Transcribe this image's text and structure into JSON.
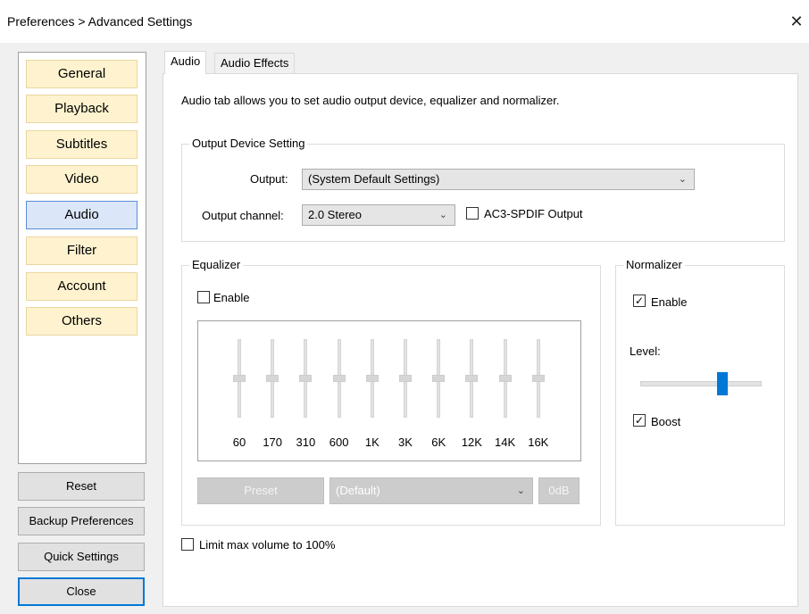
{
  "window": {
    "title": "Preferences > Advanced Settings",
    "close_glyph": "✕"
  },
  "sidebar": {
    "categories": [
      {
        "label": "General",
        "active": false
      },
      {
        "label": "Playback",
        "active": false
      },
      {
        "label": "Subtitles",
        "active": false
      },
      {
        "label": "Video",
        "active": false
      },
      {
        "label": "Audio",
        "active": true
      },
      {
        "label": "Filter",
        "active": false
      },
      {
        "label": "Account",
        "active": false
      },
      {
        "label": "Others",
        "active": false
      }
    ],
    "buttons": {
      "reset": "Reset",
      "backup": "Backup Preferences",
      "quick": "Quick Settings",
      "close": "Close"
    }
  },
  "tabs": [
    {
      "label": "Audio",
      "active": true
    },
    {
      "label": "Audio Effects",
      "active": false
    }
  ],
  "audio": {
    "description": "Audio tab allows you to set audio output device, equalizer and normalizer.",
    "output_group": {
      "title": "Output Device Setting",
      "output_label": "Output:",
      "output_value": "(System Default Settings)",
      "channel_label": "Output channel:",
      "channel_value": "2.0 Stereo",
      "spdif_label": "AC3-SPDIF Output",
      "spdif_checked": false
    },
    "equalizer": {
      "title": "Equalizer",
      "enable_label": "Enable",
      "enabled": false,
      "bands": [
        "60",
        "170",
        "310",
        "600",
        "1K",
        "3K",
        "6K",
        "12K",
        "14K",
        "16K"
      ],
      "band_levels": [
        0.5,
        0.5,
        0.5,
        0.5,
        0.5,
        0.5,
        0.5,
        0.5,
        0.5,
        0.5
      ],
      "preset_button": "Preset",
      "preset_value": "(Default)",
      "db_button": "0dB"
    },
    "normalizer": {
      "title": "Normalizer",
      "enable_label": "Enable",
      "enabled": true,
      "level_label": "Level:",
      "level_fraction": 0.68,
      "boost_label": "Boost",
      "boost": true
    },
    "limit_volume_label": "Limit max volume to 100%",
    "limit_volume": false
  },
  "colors": {
    "category_bg": "#fff3cf",
    "category_active_bg": "#dbe7f8",
    "accent": "#0078d7"
  },
  "icons": {
    "dropdown": "chevron-down-icon",
    "checkbox_checked": "check-icon"
  }
}
